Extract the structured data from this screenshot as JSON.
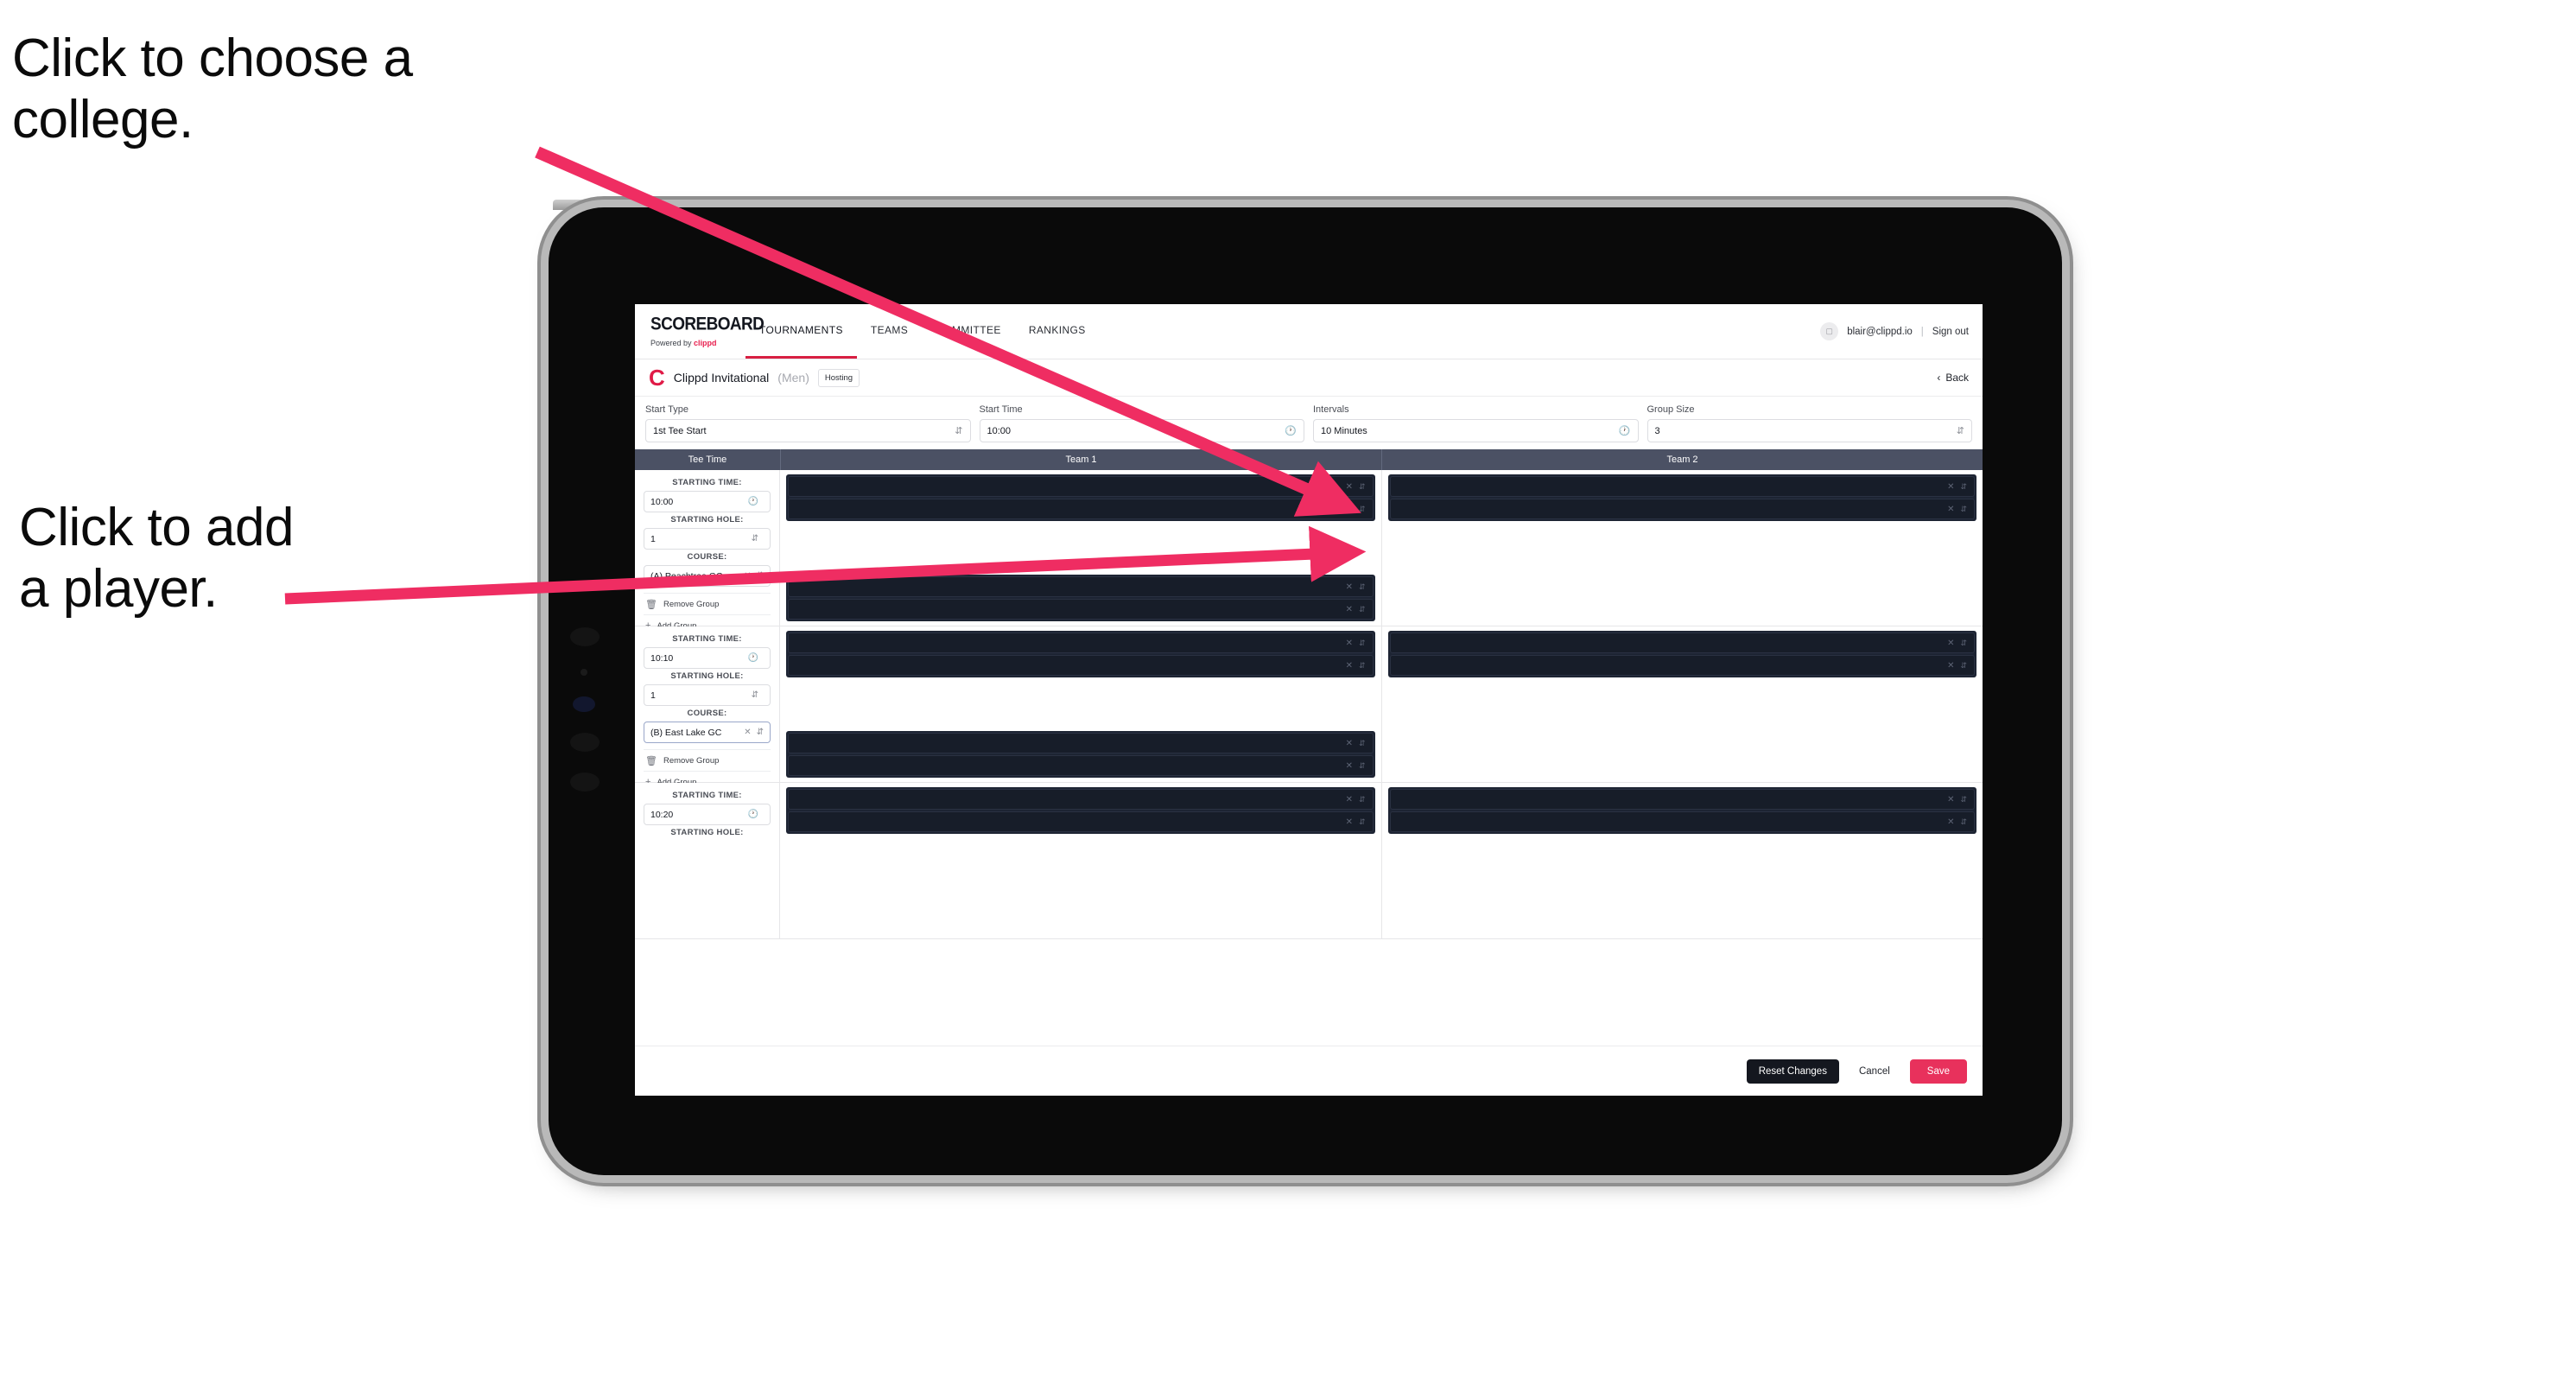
{
  "annotations": [
    {
      "id": "college",
      "text": "Click to choose a\ncollege."
    },
    {
      "id": "player",
      "text": "Click to add\na player."
    }
  ],
  "accent": {
    "pink": "#e8315c",
    "arrow": "#ef2d62",
    "navbar": "#4b5164",
    "dark": "#14171f"
  },
  "topnav": {
    "brand_title": "SCOREBOARD",
    "brand_sub_prefix": "Powered by ",
    "brand_sub_name": "clippd",
    "tabs": [
      {
        "label": "TOURNAMENTS",
        "active": true
      },
      {
        "label": "TEAMS",
        "active": false
      },
      {
        "label": "COMMITTEE",
        "active": false
      },
      {
        "label": "RANKINGS",
        "active": false
      }
    ],
    "avatar_icon": "image-placeholder-icon",
    "user_email": "blair@clippd.io",
    "separator": "|",
    "sign_out": "Sign out"
  },
  "titlebar": {
    "logo_letter": "C",
    "event_name": "Clippd Invitational",
    "event_gender": "(Men)",
    "hosting_badge": "Hosting",
    "back_chevron": "‹",
    "back_label": "Back"
  },
  "controls": [
    {
      "label": "Start Type",
      "value": "1st Tee Start",
      "icon": "stepper-icon"
    },
    {
      "label": "Start Time",
      "value": "10:00",
      "icon": "clock-icon"
    },
    {
      "label": "Intervals",
      "value": "10 Minutes",
      "icon": "clock-icon"
    },
    {
      "label": "Group Size",
      "value": "3",
      "icon": "stepper-icon"
    }
  ],
  "table": {
    "headers": [
      "Tee Time",
      "Team 1",
      "Team 2"
    ],
    "captions": {
      "starting_time": "STARTING TIME:",
      "starting_hole": "STARTING HOLE:",
      "course": "COURSE:"
    },
    "actions": {
      "remove_group": "Remove Group",
      "add_group": "Add Group",
      "remove_icon": "trash-icon",
      "add_icon": "plus-icon"
    },
    "groups": [
      {
        "starting_time": "10:00",
        "starting_hole": "1",
        "course": "(A) Peachtree GC",
        "course_focused": false,
        "team1_slots": 2,
        "team1_extra_slots": 2,
        "team2_slots": 2,
        "team2_extra_slots": 0
      },
      {
        "starting_time": "10:10",
        "starting_hole": "1",
        "course": "(B) East Lake GC",
        "course_focused": true,
        "team1_slots": 2,
        "team1_extra_slots": 2,
        "team2_slots": 2,
        "team2_extra_slots": 0
      },
      {
        "starting_time": "10:20",
        "starting_hole": "",
        "course": "",
        "course_focused": false,
        "team1_slots": 2,
        "team1_extra_slots": 0,
        "team2_slots": 2,
        "team2_extra_slots": 0
      }
    ],
    "slot_clear_icon": "×",
    "slot_stepper_icon": "⇅"
  },
  "footer": {
    "reset": "Reset Changes",
    "cancel": "Cancel",
    "save": "Save"
  }
}
